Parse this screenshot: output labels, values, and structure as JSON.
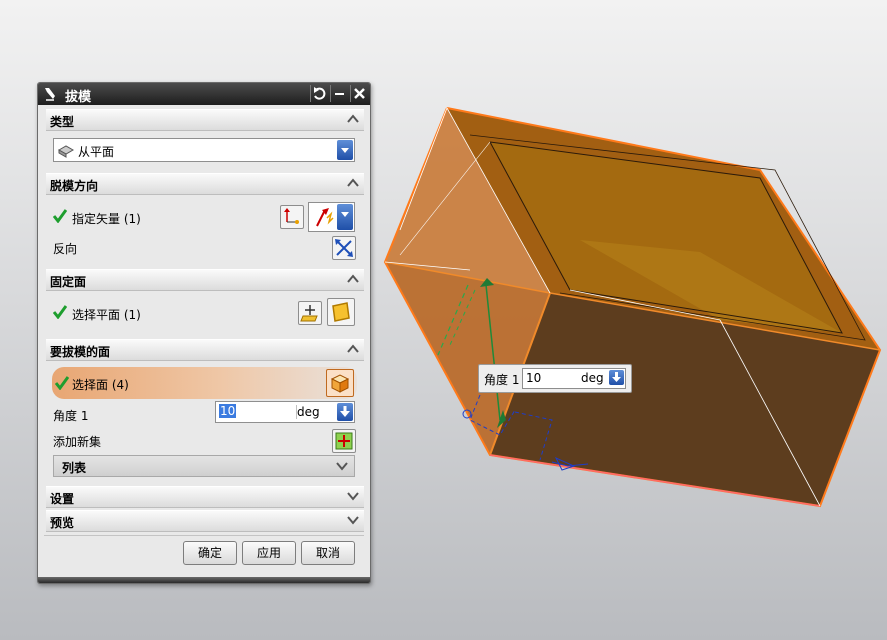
{
  "dialog": {
    "title": "拔模",
    "sections": {
      "type": {
        "header": "类型",
        "selected": "从平面"
      },
      "draw_direction": {
        "header": "脱模方向",
        "specify_vector": "指定矢量 (1)",
        "reverse": "反向"
      },
      "stationary_face": {
        "header": "固定面",
        "select_plane": "选择平面 (1)"
      },
      "faces_to_draft": {
        "header": "要拔模的面",
        "select_face": "选择面 (4)",
        "angle_label": "角度 1",
        "angle_value": "10",
        "angle_unit": "deg",
        "add_new_set": "添加新集",
        "list_label": "列表"
      },
      "settings": {
        "header": "设置"
      },
      "preview": {
        "header": "预览"
      }
    },
    "buttons": {
      "ok": "确定",
      "apply": "应用",
      "cancel": "取消"
    }
  },
  "viewport_label": {
    "label": "角度 1",
    "value": "10",
    "unit": "deg"
  },
  "colors": {
    "title_bar": "#2b2b2b",
    "highlight_row": "#e8a673",
    "model_orange": "#c67a35",
    "model_dark": "#5e3d1e",
    "edge_highlight": "#ff7a1a",
    "accent_blue": "#2a5cb8"
  }
}
